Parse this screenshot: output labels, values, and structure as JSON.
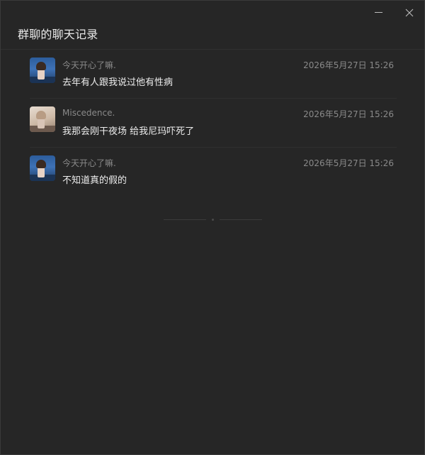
{
  "window": {
    "title": "群聊的聊天记录"
  },
  "messages": [
    {
      "sender": "今天开心了嘛.",
      "time": "2026年5月27日 15:26",
      "text": "去年有人跟我说过他有性病",
      "avatar": "blue"
    },
    {
      "sender": "Miscedence.",
      "time": "2026年5月27日 15:26",
      "text": "我那会刚干夜场  给我尼玛吓死了",
      "avatar": "light"
    },
    {
      "sender": "今天开心了嘛.",
      "time": "2026年5月27日 15:26",
      "text": "不知道真的假的",
      "avatar": "blue"
    }
  ]
}
